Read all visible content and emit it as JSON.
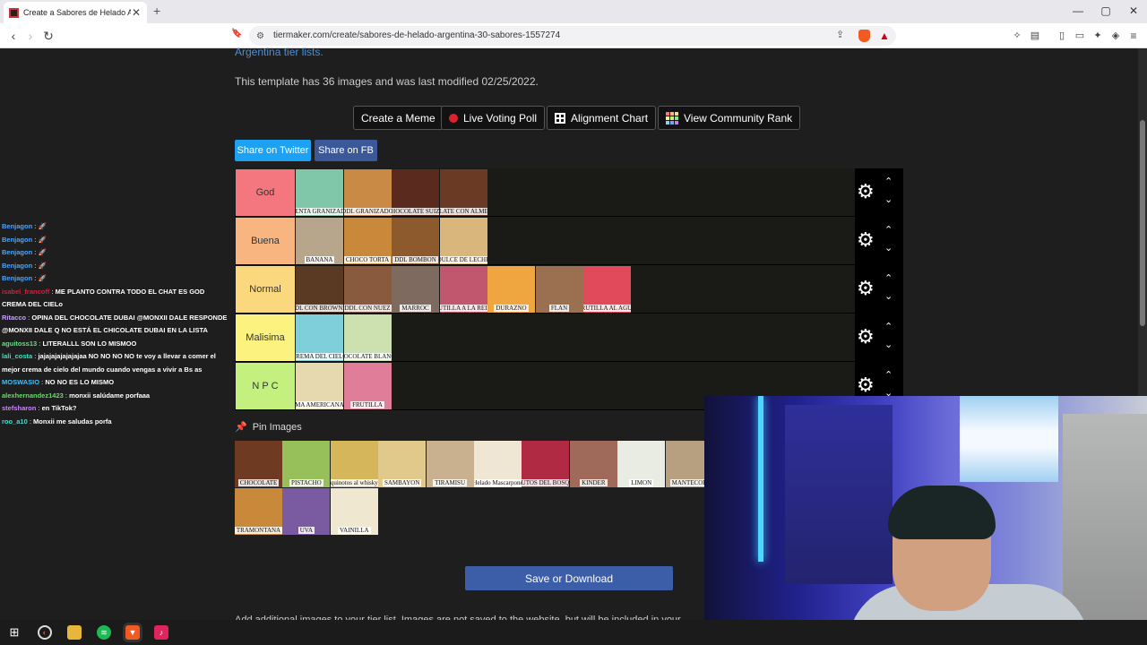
{
  "browser": {
    "tab_title": "Create a Sabores de Helado Arg",
    "tab_close": "✕",
    "new_tab": "+",
    "url": "tiermaker.com/create/sabores-de-helado-argentina-30-sabores-1557274",
    "win_min": "—",
    "win_restore": "▢",
    "win_close": "✕"
  },
  "page": {
    "link_text": "Argentina tier lists.",
    "template_info": "This template has 36 images and was last modified 02/25/2022.",
    "buttons": {
      "create_meme": "Create a Meme",
      "live_poll": "Live Voting Poll",
      "alignment": "Alignment Chart",
      "community": "View Community Rank"
    },
    "share_twitter": "Share on Twitter",
    "share_fb": "Share on FB",
    "pin_images": "Pin Images",
    "save": "Save or Download",
    "bottom_text": "Add additional images to your tier list. Images are not saved to the website, but will be included in your"
  },
  "tiers": [
    {
      "label": "God",
      "color": "#f4777f",
      "items": [
        {
          "text": "MENTA GRANIZADA",
          "bg": "#7fc7a8"
        },
        {
          "text": "DDL GRANIZADO",
          "bg": "#c98a45"
        },
        {
          "text": "CHOCOLATE SUIZO",
          "bg": "#5a2a1e"
        },
        {
          "text": "CHOCOLATE CON ALMENDRAS",
          "bg": "#6b3a24"
        }
      ]
    },
    {
      "label": "Buena",
      "color": "#f9b57f",
      "items": [
        {
          "text": "BANANA",
          "bg": "#b7a58c"
        },
        {
          "text": "CHOCO TORTA",
          "bg": "#c88a3a"
        },
        {
          "text": "DDL BOMBON",
          "bg": "#8d5a2e"
        },
        {
          "text": "DULCE DE LECHE",
          "bg": "#d9b77c"
        }
      ]
    },
    {
      "label": "Normal",
      "color": "#fbd77e",
      "items": [
        {
          "text": "DDL CON BROWNIE",
          "bg": "#5a3a22"
        },
        {
          "text": "DDL CON NUEZ",
          "bg": "#8a5a3e"
        },
        {
          "text": "MARROC",
          "bg": "#7e6a5e"
        },
        {
          "text": "FRUTILLA A LA REINA",
          "bg": "#c0576e"
        },
        {
          "text": "DURAZNO",
          "bg": "#f0a640"
        },
        {
          "text": "FLAN",
          "bg": "#9a7050"
        },
        {
          "text": "FRUTILLA AL AGUA",
          "bg": "#e04a5a"
        }
      ]
    },
    {
      "label": "Malisima",
      "color": "#fbf27f",
      "items": [
        {
          "text": "CREMA DEL CIELO",
          "bg": "#7ecfd9"
        },
        {
          "text": "CHOCOLATE BLANCO",
          "bg": "#cde0b0"
        }
      ]
    },
    {
      "label": "N P C",
      "color": "#c4f07f",
      "items": [
        {
          "text": "MA AMERICANA",
          "bg": "#e6d9b0"
        },
        {
          "text": "FRUTILLA",
          "bg": "#e07e9a"
        }
      ]
    }
  ],
  "tier_ctrl": {
    "gear": "⚙",
    "up": "⌃",
    "down": "⌄"
  },
  "pool": [
    {
      "text": "CHOCOLATE",
      "bg": "#6e3a22"
    },
    {
      "text": "PISTACHO",
      "bg": "#98c05a"
    },
    {
      "text": "quinotos al whisky",
      "bg": "#d6b65a"
    },
    {
      "text": "SAMBAYON",
      "bg": "#e0c98a"
    },
    {
      "text": "TIRAMISU",
      "bg": "#c9b08e"
    },
    {
      "text": "Helado Mascarpone",
      "bg": "#efe7d4"
    },
    {
      "text": "FRUTOS DEL BOSQUE",
      "bg": "#b02a44"
    },
    {
      "text": "KINDER",
      "bg": "#a06a5a"
    },
    {
      "text": "LIMON",
      "bg": "#e8ece2"
    },
    {
      "text": "MANTECOL",
      "bg": "#b7a080"
    },
    {
      "text": "TRAMONTANA",
      "bg": "#c88a3a"
    },
    {
      "text": "UVA",
      "bg": "#7a5aa0"
    },
    {
      "text": "VAINILLA",
      "bg": "#efe7cf"
    }
  ],
  "chat": [
    {
      "user": "Benjagon",
      "color": "#4aa3ff",
      "msg": "🚀"
    },
    {
      "user": "Benjagon",
      "color": "#4aa3ff",
      "msg": "🚀"
    },
    {
      "user": "Benjagon",
      "color": "#4aa3ff",
      "msg": "🚀"
    },
    {
      "user": "Benjagon",
      "color": "#4aa3ff",
      "msg": "🚀"
    },
    {
      "user": "Benjagon",
      "color": "#4aa3ff",
      "msg": "🚀"
    },
    {
      "user": "isabel_francoff",
      "color": "#d02040",
      "msg": "ME PLANTO CONTRA TODO EL CHAT ES GOD CREMA DEL CIELo"
    },
    {
      "user": "Ritacco",
      "color": "#c8a0ff",
      "msg": "OPINA DEL CHOCOLATE DUBAI @MONXII DALE RESPONDE @MONXII DALE Q NO ESTÁ EL CHICOLATE DUBAI EN LA LISTA"
    },
    {
      "user": "aguitoss13",
      "color": "#60e080",
      "msg": "LITERALLL SON LO MISMOO"
    },
    {
      "user": "lali_costa",
      "color": "#40e0c0",
      "msg": "jajajajajajajajaa NO NO NO NO te voy a llevar a comer el mejor crema de cielo del mundo cuando vengas a vivir a Bs as"
    },
    {
      "user": "MOSWASIO",
      "color": "#40c0ff",
      "msg": "NO NO ES LO MISMO"
    },
    {
      "user": "alexhernandez1423",
      "color": "#60e060",
      "msg": "monxii salúdame porfaaa"
    },
    {
      "user": "stefsharon",
      "color": "#d080ff",
      "msg": "en TikTok?"
    },
    {
      "user": "roo_a10",
      "color": "#40e0d0",
      "msg": "Monxii me saludas porfa"
    }
  ]
}
